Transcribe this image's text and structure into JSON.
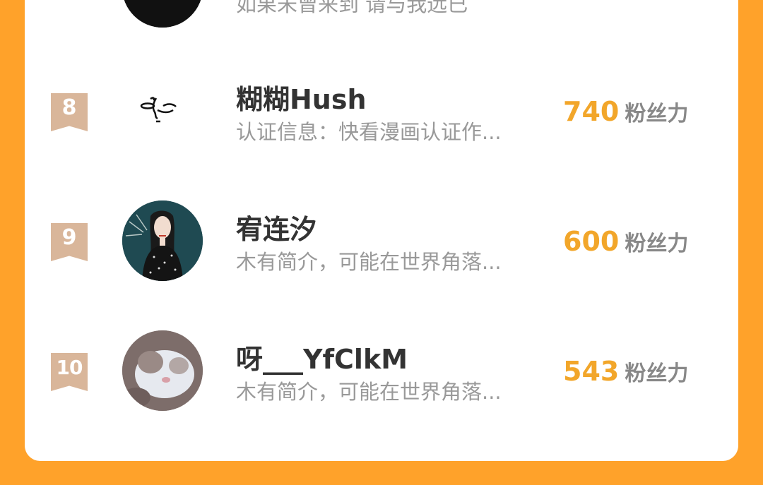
{
  "top_partial": {
    "desc": "如果未曾来到 请与我远已"
  },
  "rows": [
    {
      "rank": "8",
      "name": "糊糊Hush",
      "desc": "认证信息：快看漫画认证作...",
      "score": "740",
      "unit": "粉丝力"
    },
    {
      "rank": "9",
      "name": "宥连汐",
      "desc": "木有简介，可能在世界角落...",
      "score": "600",
      "unit": "粉丝力"
    },
    {
      "rank": "10",
      "name": "呀___YfClkM",
      "desc": "木有简介，可能在世界角落...",
      "score": "543",
      "unit": "粉丝力"
    }
  ],
  "colors": {
    "background": "#FFA22A",
    "rank_badge": "#D9B69A",
    "score": "#F2A62A"
  }
}
